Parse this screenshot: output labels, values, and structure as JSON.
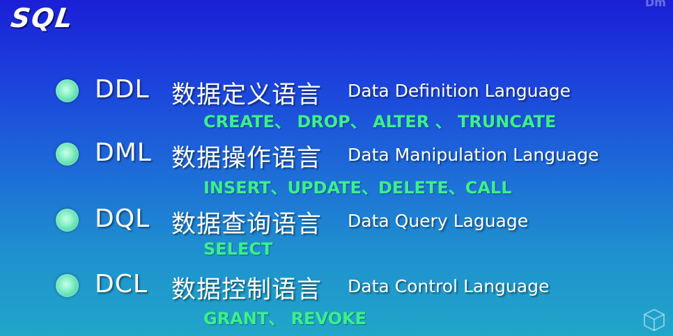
{
  "slide": {
    "title": "SQL",
    "corner_text": "Dm",
    "items": [
      {
        "abbr": "DDL",
        "cn": "数据定义语言",
        "en": "Data Definition Language",
        "commands": "CREATE、 DROP、 ALTER 、 TRUNCATE"
      },
      {
        "abbr": "DML",
        "cn": "数据操作语言",
        "en": "Data Manipulation Language",
        "commands": "INSERT、UPDATE、DELETE、CALL"
      },
      {
        "abbr": "DQL",
        "cn": "数据查询语言",
        "en": "Data Query Laguage",
        "commands": "SELECT"
      },
      {
        "abbr": "DCL",
        "cn": "数据控制语言",
        "en": "Data Control Language",
        "commands": "GRANT、 REVOKE"
      }
    ]
  },
  "colors": {
    "command_text": "#3cf08c",
    "bullet": "#8cf0c8",
    "background_top": "#1a1fd6",
    "background_bottom": "#20a6c9"
  },
  "icons": {
    "bullet": "circle-bullet-icon",
    "corner": "cube-icon"
  }
}
